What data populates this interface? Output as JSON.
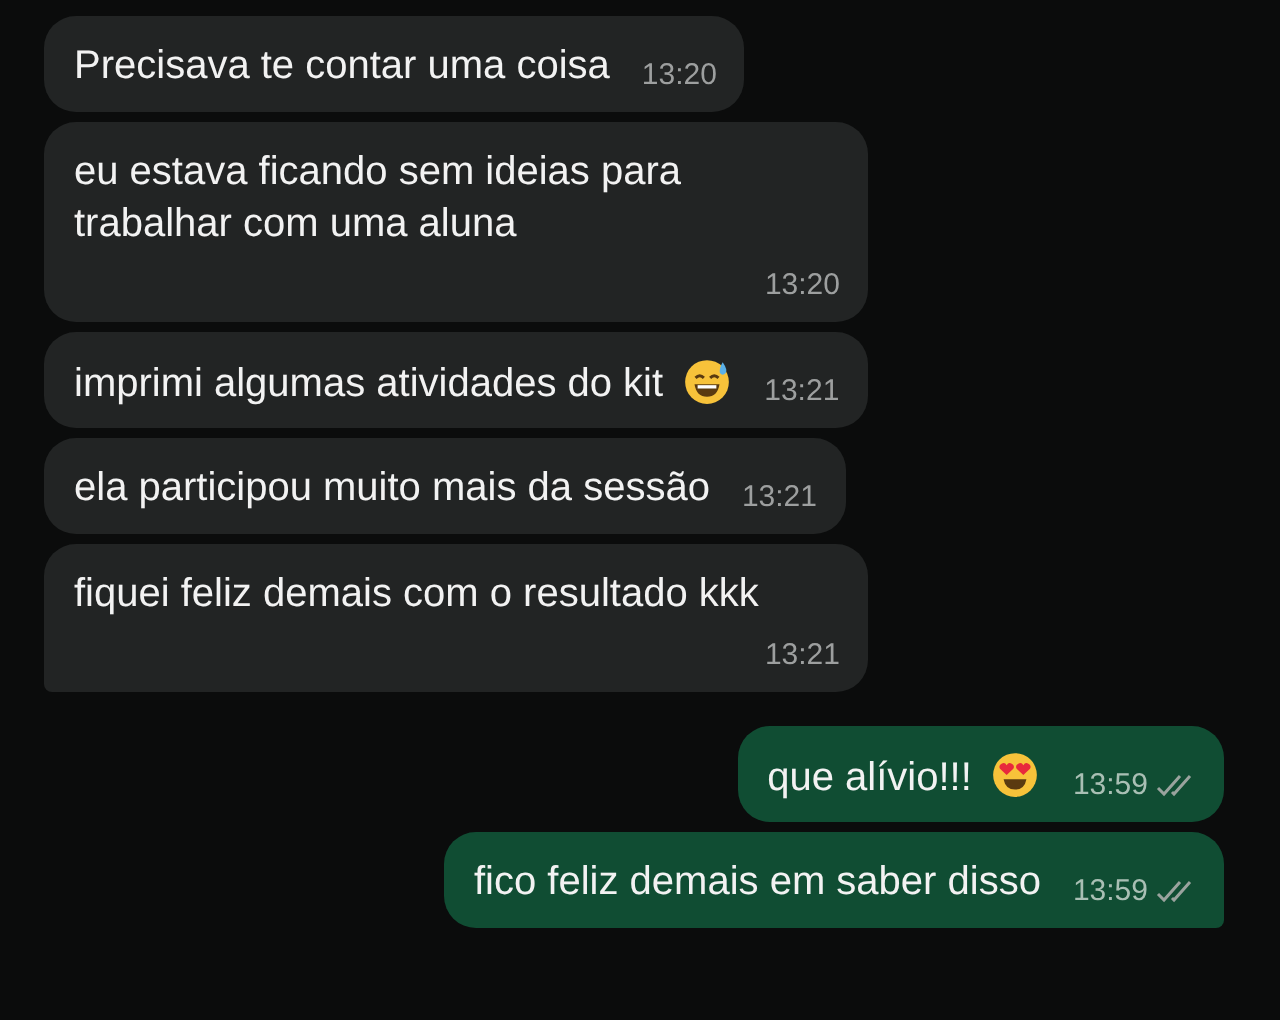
{
  "messages": [
    {
      "outgoing": false,
      "kind": "plain",
      "text": "Precisava te contar uma coisa",
      "time": "13:20",
      "tail": false
    },
    {
      "outgoing": false,
      "kind": "plain",
      "text": "eu estava ficando sem ideias para trabalhar com uma aluna",
      "time": "13:20",
      "tail": false
    },
    {
      "outgoing": false,
      "kind": "sweat-smile",
      "text": "imprimi algumas atividades do kit",
      "time": "13:21",
      "tail": false
    },
    {
      "outgoing": false,
      "kind": "plain",
      "text": "ela participou muito mais da sessão",
      "time": "13:21",
      "tail": false
    },
    {
      "outgoing": false,
      "kind": "plain",
      "text": "fiquei feliz demais com o resultado kkk",
      "time": "13:21",
      "tail": true
    },
    {
      "outgoing": true,
      "kind": "heart-eyes",
      "text": "que alívio!!!",
      "time": "13:59",
      "delivered": true,
      "tail": false
    },
    {
      "outgoing": true,
      "kind": "plain",
      "text": "fico feliz demais em saber disso",
      "time": "13:59",
      "delivered": true,
      "tail": true
    }
  ]
}
